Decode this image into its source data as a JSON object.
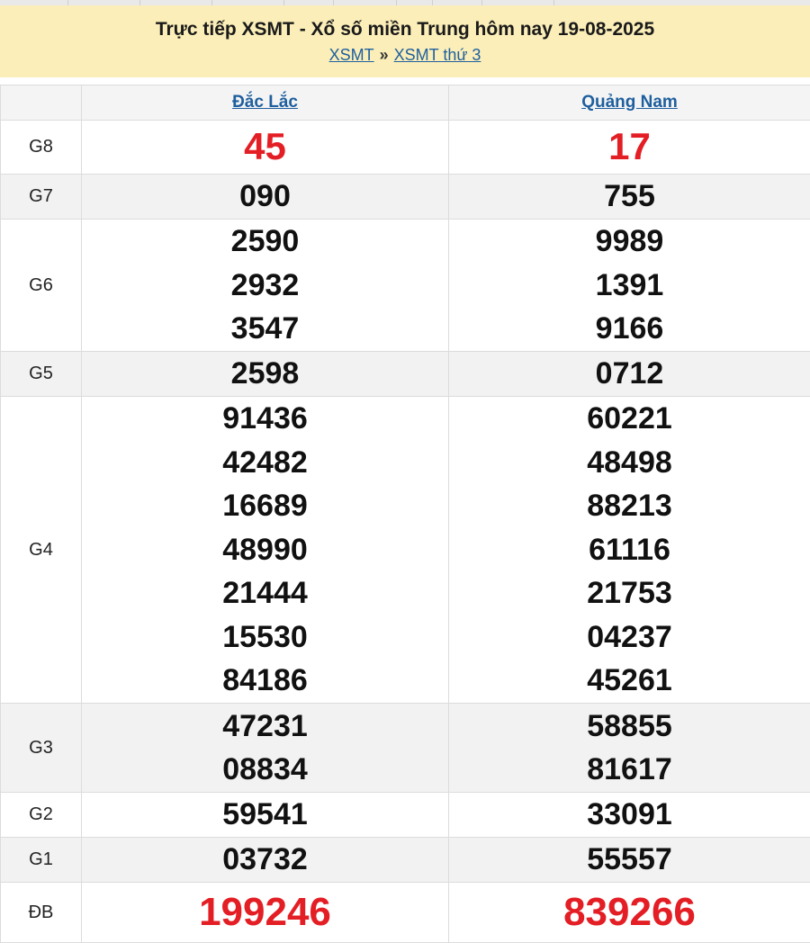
{
  "header": {
    "title": "Trực tiếp XSMT - Xổ số miền Trung hôm nay 19-08-2025",
    "breadcrumb": [
      {
        "label": "XSMT"
      },
      {
        "label": "XSMT thứ 3"
      }
    ],
    "separator": "»"
  },
  "colors": {
    "header_bg": "#fbeeb8",
    "link": "#1f5f9e",
    "special_number": "#e31e24",
    "shade": "#f2f2f2"
  },
  "provinces": [
    {
      "name": "Đắc Lắc"
    },
    {
      "name": "Quảng Nam"
    }
  ],
  "prizes": [
    {
      "label": "G8",
      "values": [
        [
          "45"
        ],
        [
          "17"
        ]
      ]
    },
    {
      "label": "G7",
      "values": [
        [
          "090"
        ],
        [
          "755"
        ]
      ]
    },
    {
      "label": "G6",
      "values": [
        [
          "2590",
          "2932",
          "3547"
        ],
        [
          "9989",
          "1391",
          "9166"
        ]
      ]
    },
    {
      "label": "G5",
      "values": [
        [
          "2598"
        ],
        [
          "0712"
        ]
      ]
    },
    {
      "label": "G4",
      "values": [
        [
          "91436",
          "42482",
          "16689",
          "48990",
          "21444",
          "15530",
          "84186"
        ],
        [
          "60221",
          "48498",
          "88213",
          "61116",
          "21753",
          "04237",
          "45261"
        ]
      ]
    },
    {
      "label": "G3",
      "values": [
        [
          "47231",
          "08834"
        ],
        [
          "58855",
          "81617"
        ]
      ]
    },
    {
      "label": "G2",
      "values": [
        [
          "59541"
        ],
        [
          "33091"
        ]
      ]
    },
    {
      "label": "G1",
      "values": [
        [
          "03732"
        ],
        [
          "55557"
        ]
      ]
    },
    {
      "label": "ĐB",
      "values": [
        [
          "199246"
        ],
        [
          "839266"
        ]
      ]
    }
  ]
}
